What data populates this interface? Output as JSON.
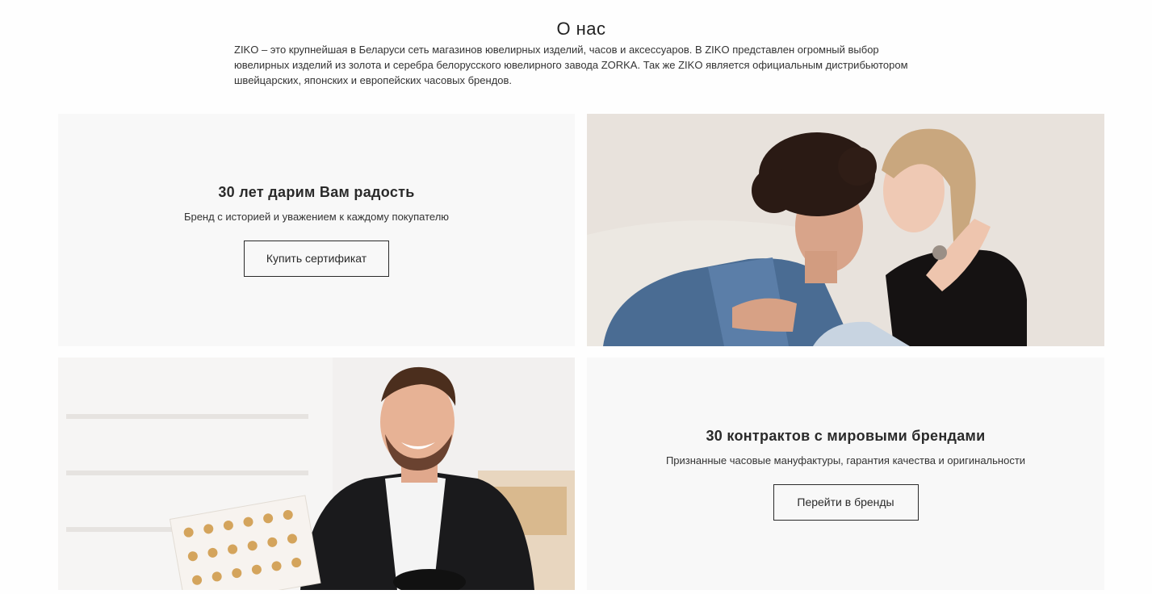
{
  "about": {
    "title": "О нас",
    "text": "ZIKO – это крупнейшая в Беларуси сеть магазинов ювелирных изделий, часов и аксессуаров. В ZIKO представлен огромный выбор ювелирных изделий из золота и серебра белорусского ювелирного завода ZORKA. Так же ZIKO является официальным дистрибьютором швейцарских, японских и европейских часовых брендов."
  },
  "cards": [
    {
      "heading": "30 лет дарим Вам радость",
      "subtitle": "Бренд с историей и уважением к каждому покупателю",
      "button_label": "Купить сертификат"
    },
    {
      "heading": "30 контрактов с мировыми брендами",
      "subtitle": "Признанные часовые мануфактуры, гарантия качества и оригинальности",
      "button_label": "Перейти в бренды"
    }
  ],
  "colors": {
    "card_background": "#f8f8f8",
    "text": "#2b2b2b"
  }
}
